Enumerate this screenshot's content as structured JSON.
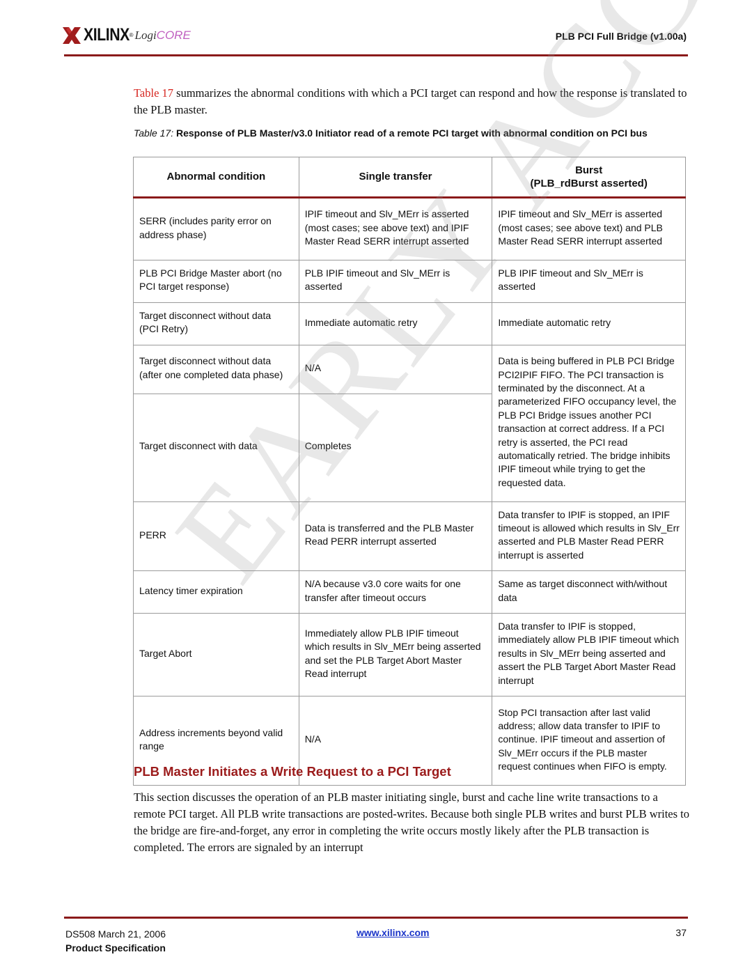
{
  "header": {
    "logo_text": "XILINX",
    "logo_registered": "®",
    "logicore_prefix": "Logi",
    "logicore_suffix": "CORE",
    "doc_title": "PLB PCI Full Bridge (v1.00a)",
    "icons": {
      "logo": "xilinx-logo-icon"
    },
    "colors": {
      "rule": "#8b1a1a",
      "brand": "#8b1a1a"
    }
  },
  "intro": {
    "table_ref": "Table 17",
    "text": " summarizes the abnormal conditions with which a PCI target can respond and how the response is translated to the PLB master."
  },
  "table": {
    "caption_label": "Table  17:",
    "caption_text": " Response of PLB Master/v3.0 Initiator read of a remote PCI target with abnormal condition on PCI bus",
    "headers": {
      "condition": "Abnormal condition",
      "single": "Single transfer",
      "burst_line1": "Burst",
      "burst_line2": "(PLB_rdBurst asserted)"
    },
    "rows": [
      {
        "condition": "SERR (includes parity error on address phase)",
        "single": "IPIF timeout and Slv_MErr is asserted (most cases; see above text) and IPIF Master Read SERR interrupt asserted",
        "burst": "IPIF timeout and Slv_MErr is asserted (most cases; see above text) and PLB Master Read SERR interrupt asserted"
      },
      {
        "condition": "PLB PCI Bridge Master abort (no PCI target response)",
        "single": "PLB IPIF timeout and Slv_MErr is asserted",
        "burst": "PLB IPIF timeout and Slv_MErr is asserted"
      },
      {
        "condition": "Target disconnect without data (PCI Retry)",
        "single": "Immediate automatic retry",
        "burst": "Immediate automatic retry"
      },
      {
        "condition": "Target disconnect without data (after one completed data phase)",
        "single": "N/A",
        "burst": "Data is being buffered in PLB PCI Bridge PCI2IPIF FIFO. The PCI transaction is terminated by the disconnect. At a parameterized FIFO occupancy level, the PLB PCI Bridge issues another PCI transaction at correct address. If a PCI retry is asserted, the PCI read automatically retried. The bridge inhibits IPIF timeout while trying to get the requested data."
      },
      {
        "condition": "Target disconnect with data",
        "single": "Completes"
      },
      {
        "condition": "PERR",
        "single": "Data is transferred and the PLB Master Read PERR interrupt asserted",
        "burst": "Data transfer to IPIF is stopped, an IPIF timeout is allowed which results in Slv_Err asserted and PLB Master Read PERR interrupt is asserted"
      },
      {
        "condition": "Latency timer expiration",
        "single": "N/A because v3.0 core waits for one transfer after timeout occurs",
        "burst": "Same as target disconnect with/without data"
      },
      {
        "condition": "Target Abort",
        "single": "Immediately allow PLB IPIF timeout which results in Slv_MErr being asserted and set the PLB Target Abort Master Read interrupt",
        "burst": "Data transfer to IPIF is stopped, immediately allow PLB IPIF timeout which results in Slv_MErr being asserted and assert the PLB Target Abort Master Read interrupt"
      },
      {
        "condition": "Address increments beyond valid range",
        "single": "N/A",
        "burst": "Stop PCI transaction after last valid address; allow data transfer to IPIF to continue. IPIF timeout and assertion of Slv_MErr occurs if the PLB master request continues when FIFO is empty."
      }
    ]
  },
  "watermark": "EARLY ACCESS",
  "section": {
    "heading": "PLB Master Initiates a Write Request to a PCI Target",
    "heading_color": "#9b1b1b",
    "body": "This section discusses the operation of an PLB master initiating single, burst and cache line write transactions to a remote PCI target. All PLB write transactions are posted-writes. Because both single PLB writes and burst PLB writes to the bridge are fire-and-forget, any error in completing the write occurs mostly likely after the PLB transaction is completed. The errors are signaled by an interrupt"
  },
  "footer": {
    "doc_id_date": "DS508 March 21, 2006",
    "spec_label": "Product Specification",
    "link": "www.xilinx.com",
    "link_color": "#1a34c8",
    "page_number": "37"
  }
}
